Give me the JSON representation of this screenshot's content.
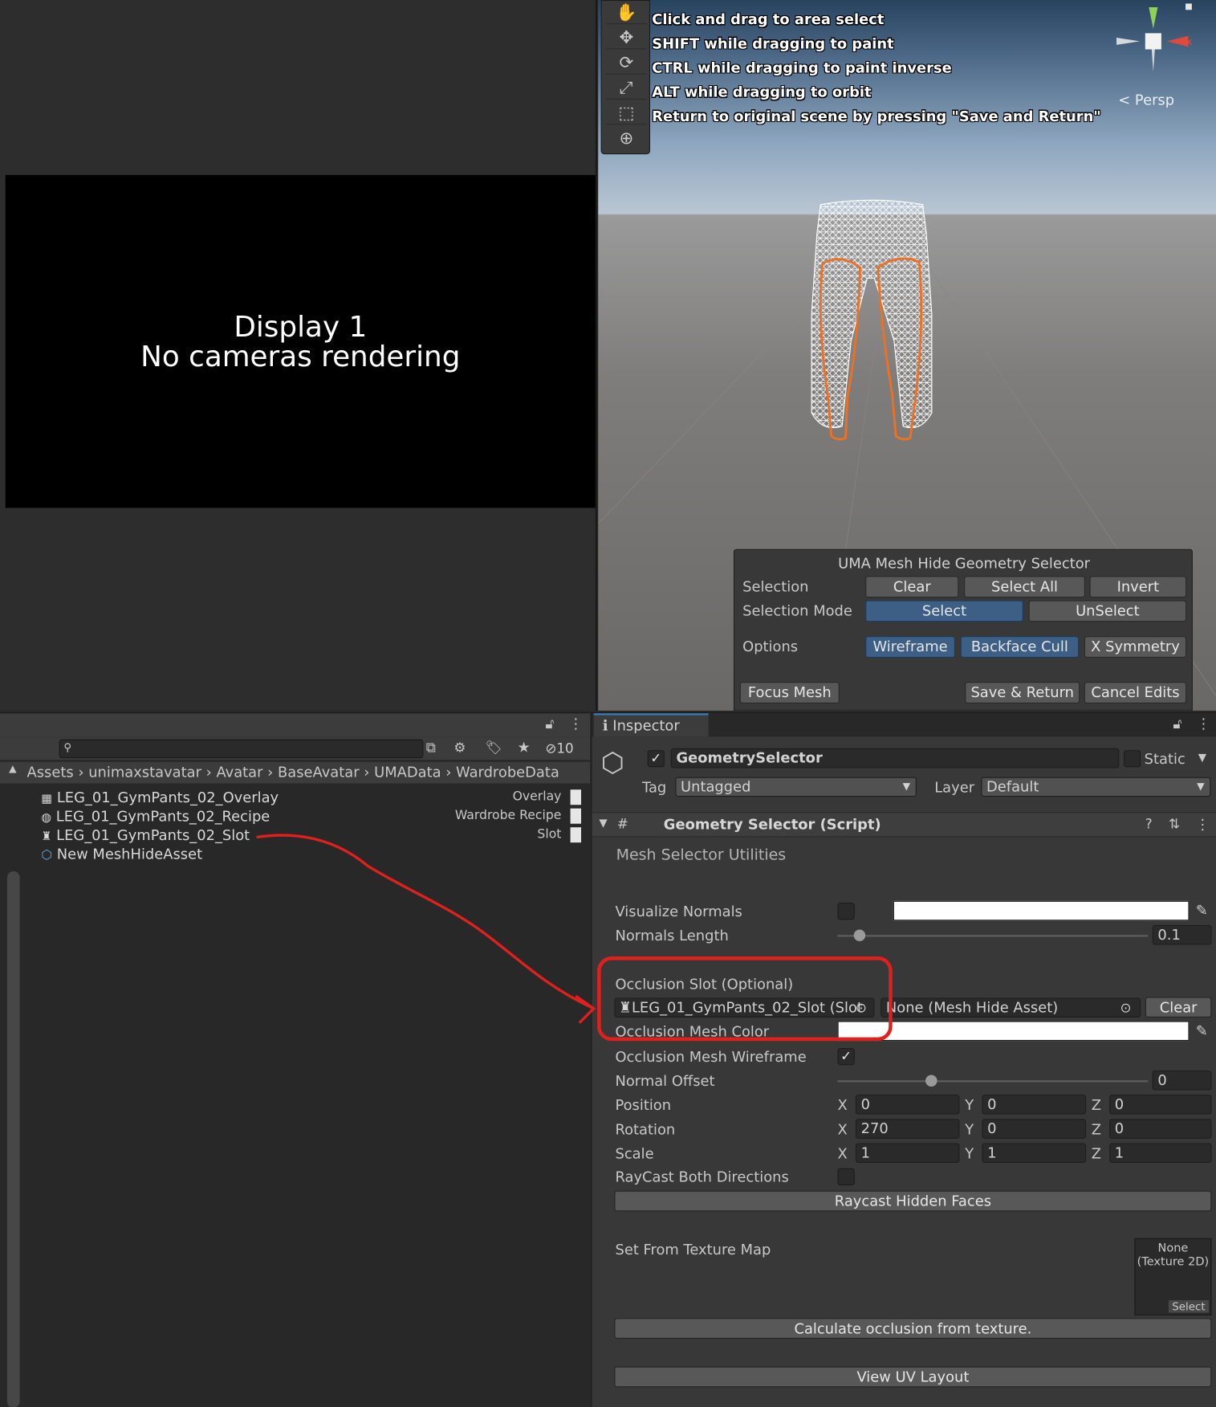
{
  "game": {
    "line1": "Display 1",
    "line2": "No cameras rendering"
  },
  "scene": {
    "hints": [
      "Click and drag to area select",
      "SHIFT while dragging to paint",
      "CTRL while dragging to paint inverse",
      "ALT while dragging to orbit",
      "Return to original scene by pressing \"Save and Return\""
    ],
    "persp": "< Persp",
    "gizmo_x": "x"
  },
  "panel": {
    "title": "UMA Mesh Hide Geometry Selector",
    "selection_label": "Selection",
    "clear": "Clear",
    "select_all": "Select All",
    "invert": "Invert",
    "mode_label": "Selection Mode",
    "select": "Select",
    "unselect": "UnSelect",
    "options_label": "Options",
    "wireframe": "Wireframe",
    "backface_cull": "Backface Cull",
    "x_symmetry": "X Symmetry",
    "focus_mesh": "Focus Mesh",
    "save_return": "Save & Return",
    "cancel_edits": "Cancel Edits"
  },
  "project": {
    "hidden_count": "10",
    "breadcrumbs": [
      "Assets",
      "unimaxstavatar",
      "Avatar",
      "BaseAvatar",
      "UMAData",
      "WardrobeData"
    ],
    "assets": [
      {
        "name": "LEG_01_GymPants_02_Overlay",
        "type": "Overlay"
      },
      {
        "name": "LEG_01_GymPants_02_Recipe",
        "type": "Wardrobe Recipe"
      },
      {
        "name": "LEG_01_GymPants_02_Slot",
        "type": "Slot"
      },
      {
        "name": "New MeshHideAsset",
        "type": ""
      }
    ]
  },
  "inspector": {
    "tab": "Inspector",
    "object_name": "GeometrySelector",
    "static_label": "Static",
    "tag_label": "Tag",
    "tag_value": "Untagged",
    "layer_label": "Layer",
    "layer_value": "Default",
    "component": "Geometry Selector (Script)",
    "section": "Mesh Selector Utilities",
    "visualize_normals": "Visualize Normals",
    "normals_length": "Normals Length",
    "normals_length_value": "0.1",
    "normals_length_fraction": 0.07,
    "occlusion_slot": "Occlusion Slot (Optional)",
    "slot_value": "LEG_01_GymPants_02_Slot (Slot",
    "mesh_hide_value": "None (Mesh Hide Asset)",
    "clear": "Clear",
    "occlusion_color": "Occlusion Mesh Color",
    "occlusion_wireframe": "Occlusion Mesh Wireframe",
    "normal_offset": "Normal Offset",
    "normal_offset_value": "0",
    "normal_offset_fraction": 0.3,
    "position": "Position",
    "rotation": "Rotation",
    "scale": "Scale",
    "pos": [
      "0",
      "0",
      "0"
    ],
    "rot": [
      "270",
      "0",
      "0"
    ],
    "scl": [
      "1",
      "1",
      "1"
    ],
    "axis": [
      "X",
      "Y",
      "Z"
    ],
    "raycast_both": "RayCast Both Directions",
    "raycast_hidden": "Raycast Hidden Faces",
    "texture_map": "Set From Texture Map",
    "texture_none": "None",
    "texture_type": "(Texture 2D)",
    "texture_select": "Select",
    "calc_occlusion": "Calculate occlusion from texture.",
    "view_uv": "View UV Layout"
  },
  "colors": {
    "accent": "#3e5f85",
    "annotation": "#e0201c",
    "selection_outline": "#f07020"
  }
}
